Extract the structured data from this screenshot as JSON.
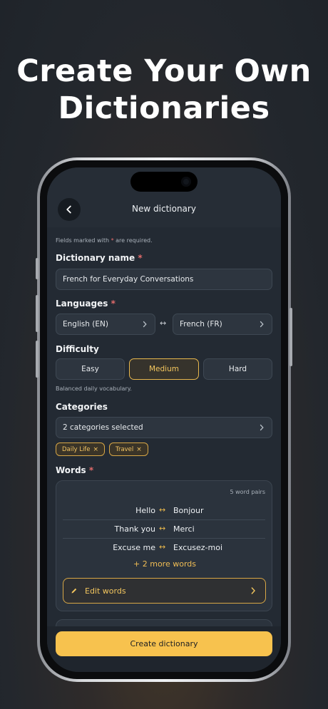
{
  "headline": {
    "line1": "Create Your Own",
    "line2": "Dictionaries"
  },
  "appbar": {
    "title": "New dictionary",
    "back_icon": "chevron-left-icon"
  },
  "form": {
    "required_note_prefix": "Fields marked with ",
    "required_note_star": "*",
    "required_note_suffix": " are required.",
    "required_star": "*",
    "name": {
      "label": "Dictionary name",
      "value": "French for Everyday Conversations"
    },
    "languages": {
      "label": "Languages",
      "source": "English (EN)",
      "target": "French (FR)",
      "swap_symbol": "↔"
    },
    "difficulty": {
      "label": "Difficulty",
      "options": [
        "Easy",
        "Medium",
        "Hard"
      ],
      "selected": "Medium",
      "hint": "Balanced daily vocabulary."
    },
    "categories": {
      "label": "Categories",
      "summary": "2 categories selected",
      "chips": [
        "Daily Life",
        "Travel"
      ],
      "remove_symbol": "×"
    },
    "words": {
      "label": "Words",
      "count": "5 word pairs",
      "arrow_symbol": "↔",
      "pairs": [
        {
          "source": "Hello",
          "target": "Bonjour"
        },
        {
          "source": "Thank you",
          "target": "Merci"
        },
        {
          "source": "Excuse me",
          "target": "Excusez-moi"
        }
      ],
      "more": "+ 2 more words",
      "edit_label": "Edit words"
    }
  },
  "create_button": "Create dictionary",
  "colors": {
    "accent": "#f7c24e",
    "background": "#232a33",
    "required": "#e26b6b"
  }
}
